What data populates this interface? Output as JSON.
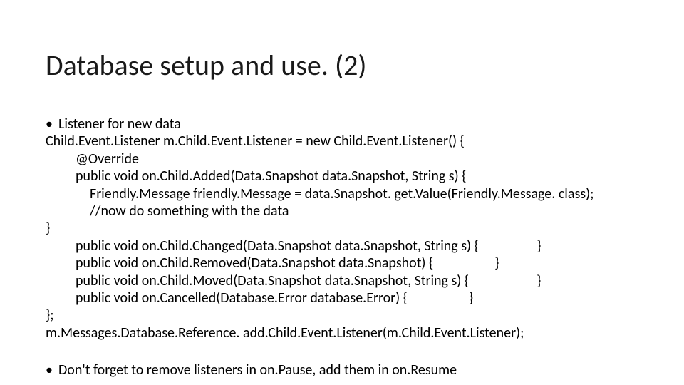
{
  "slide": {
    "title": "Database setup and use. (2)",
    "bullet1": "Listener for new data",
    "code": {
      "l1": "Child.Event.Listener m.Child.Event.Listener = new Child.Event.Listener() {",
      "l2": "@Override",
      "l3": "public void on.Child.Added(Data.Snapshot data.Snapshot, String s) {",
      "l4": "Friendly.Message friendly.Message = data.Snapshot. get.Value(Friendly.Message. class);",
      "l5": "//now do something with the data",
      "l6": "}",
      "l7": "public void on.Child.Changed(Data.Snapshot data.Snapshot, String s) {                  }",
      "l8": "public void on.Child.Removed(Data.Snapshot data.Snapshot) {                   }",
      "l9": "public void on.Child.Moved(Data.Snapshot data.Snapshot, String s) {                     }",
      "l10": "public void on.Cancelled(Database.Error database.Error) {                   }",
      "l11": "};",
      "l12": "m.Messages.Database.Reference. add.Child.Event.Listener(m.Child.Event.Listener);"
    },
    "bullet2": "Don't forget to remove listeners in on.Pause, add them in on.Resume"
  }
}
